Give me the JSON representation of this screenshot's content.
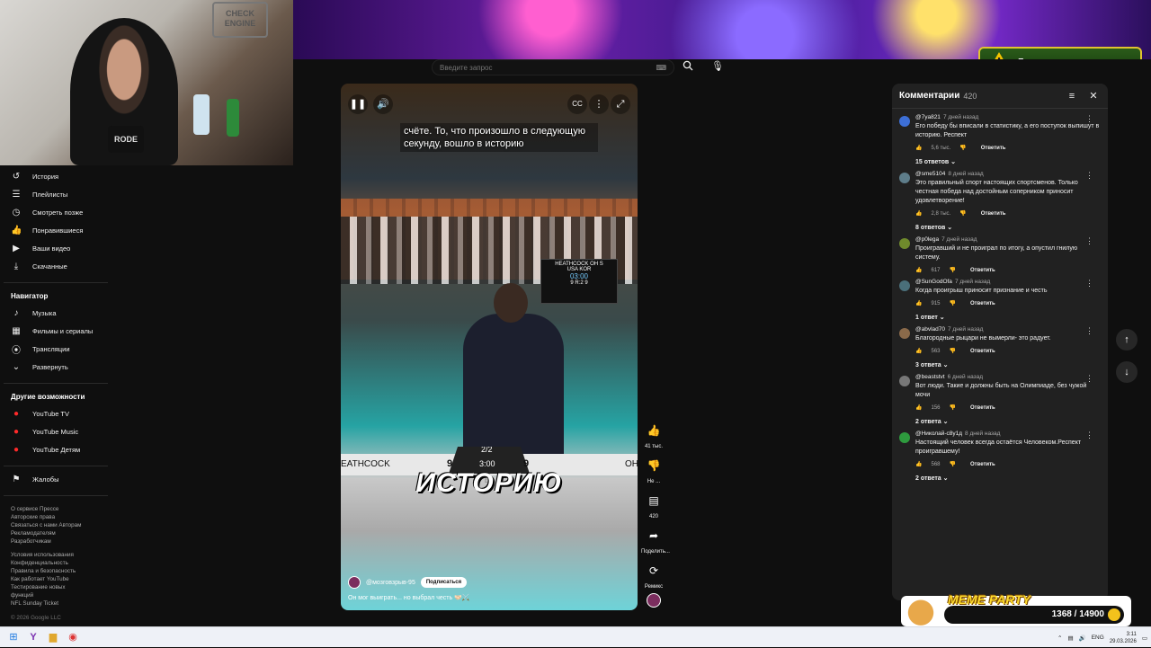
{
  "webcam": {
    "sign_text": "CHECK ENGINE",
    "mic_label": "RODE"
  },
  "donations": {
    "label": "Донаты отключены",
    "close_glyph": "×",
    "icon": "warning-icon"
  },
  "search": {
    "placeholder": "Введите запрос"
  },
  "sidebar": {
    "items": [
      {
        "label": "История",
        "icon": "history-icon"
      },
      {
        "label": "Плейлисты",
        "icon": "playlists-icon"
      },
      {
        "label": "Смотреть позже",
        "icon": "watch-later-icon"
      },
      {
        "label": "Понравившиеся",
        "icon": "like-icon"
      },
      {
        "label": "Ваши видео",
        "icon": "your-videos-icon"
      },
      {
        "label": "Скачанные",
        "icon": "download-icon"
      }
    ],
    "nav_heading": "Навигатор",
    "nav_items": [
      {
        "label": "Музыка",
        "icon": "music-icon"
      },
      {
        "label": "Фильмы и сериалы",
        "icon": "movies-icon"
      },
      {
        "label": "Трансляции",
        "icon": "live-icon"
      },
      {
        "label": "Развернуть",
        "icon": "chevron-down-icon"
      }
    ],
    "other_heading": "Другие возможности",
    "other_items": [
      {
        "label": "YouTube TV"
      },
      {
        "label": "YouTube Music"
      },
      {
        "label": "YouTube Детям"
      }
    ],
    "report_label": "Жалобы",
    "footer_links_1": [
      "О сервисе  Прессе",
      "Авторские права",
      "Связаться с нами  Авторам",
      "Рекламодателям",
      "Разработчикам"
    ],
    "footer_links_2": [
      "Условия использования",
      "Конфиденциальность",
      "Правила и безопасность",
      "Как работает YouTube",
      "Тестирование новых",
      "функций",
      "NFL Sunday Ticket"
    ],
    "copyright": "© 2026 Google LLC"
  },
  "player": {
    "caption": "счёте. То, что произошло в следующую секунду, вошло в историю",
    "scoreboard": {
      "left_name": "HEATHCOCK",
      "right_name": "OH S",
      "left_country": "USA",
      "right_country": "KOR",
      "time": "03:00",
      "round": "R:2",
      "left_score": "9",
      "right_score": "9"
    },
    "overlay": {
      "left_name": "EATHCOCK",
      "left_score": "9",
      "period": "2/2",
      "time": "3:00",
      "right_score": "9",
      "right_name": "OH",
      "below": "b8"
    },
    "big_title": "ИСТОРИЮ",
    "channel": "@мозговзрыв-95",
    "subscribe": "Подписаться",
    "description": "Он мог выиграть... но выбрал честь 🤝🏻⚔️"
  },
  "actions": [
    {
      "label": "41 тыс.",
      "icon": "thumbs-up-icon"
    },
    {
      "label": "Не ...",
      "icon": "thumbs-down-icon"
    },
    {
      "label": "420",
      "icon": "comment-icon"
    },
    {
      "label": "Поделить...",
      "icon": "share-icon"
    },
    {
      "label": "Ремикс",
      "icon": "remix-icon"
    }
  ],
  "comments_panel": {
    "title": "Комментарии",
    "count": "420",
    "reply_label": "Ответить",
    "comments": [
      {
        "author": "@7ya821",
        "ago": "7 дней назад",
        "text": "Его победу бы вписали в статистику, а его поступок выпишут в историю. Респект",
        "likes": "5,6 тыс.",
        "replies": "15 ответов",
        "avatar_color": "#3d6fd6"
      },
      {
        "author": "@sme5104",
        "ago": "8 дней назад",
        "text": "Это правильный спорт настоящих спортсменов. Только честная победа над достойным соперником приносит удовлетворение!",
        "likes": "2,8 тыс.",
        "replies": "8 ответов",
        "avatar_color": "#5e7d8a"
      },
      {
        "author": "@p0lega",
        "ago": "7 дней назад",
        "text": "Проигравший и не проиграл по итогу, а опустил гнилую систему.",
        "likes": "617",
        "replies": "",
        "avatar_color": "#6f8a2c"
      },
      {
        "author": "@SunGodOfa",
        "ago": "7 дней назад",
        "text": "Когда проигрыш приносит признание и честь",
        "likes": "915",
        "replies": "1 ответ",
        "avatar_color": "#4a6f7a"
      },
      {
        "author": "@abvlad70",
        "ago": "7 дней назад",
        "text": "Благородные рыцари не вымерли- это радует.",
        "likes": "563",
        "replies": "3 ответа",
        "avatar_color": "#8a6a4a"
      },
      {
        "author": "@beaststvt",
        "ago": "6 дней назад",
        "text": "Вот люди. Такие и должны быть на Олимпиаде, без чужой мочи",
        "likes": "156",
        "replies": "2 ответа",
        "avatar_color": "#777777"
      },
      {
        "author": "@Николай-с8у1д",
        "ago": "8 дней назад",
        "text": "Настоящий человек всегда остаётся Человеком.Респект проигравшему!",
        "likes": "568",
        "replies": "2 ответа",
        "avatar_color": "#2e9a3e"
      }
    ]
  },
  "meme_widget": {
    "title": "MEME PARTY",
    "progress_text": "1368 / 14900"
  },
  "taskbar": {
    "lang": "ENG",
    "time": "3:11",
    "date": "29.03.2026"
  }
}
